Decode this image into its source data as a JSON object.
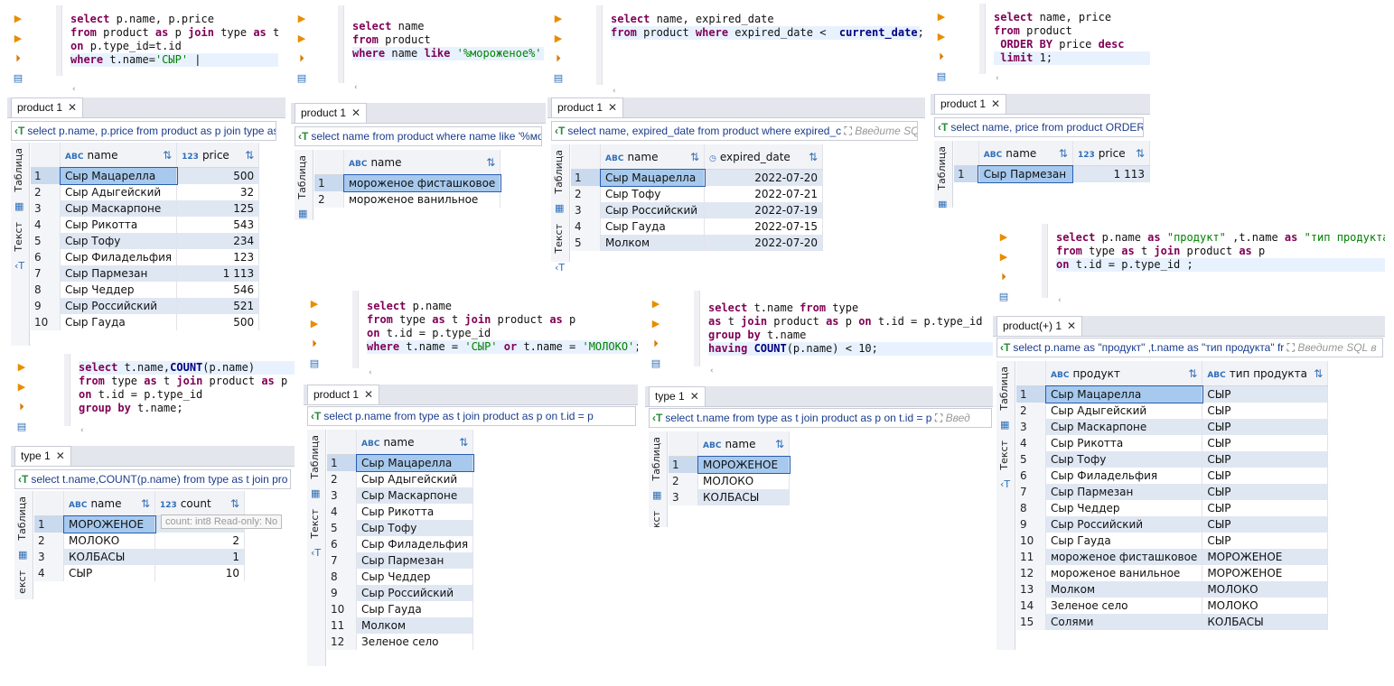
{
  "panels": [
    {
      "sql": [
        [
          [
            "kw",
            "select "
          ],
          [
            "t",
            "p.name, p.price"
          ]
        ],
        [
          [
            "kw",
            "from "
          ],
          [
            "t",
            "product "
          ],
          [
            "kw",
            "as "
          ],
          [
            "t",
            "p "
          ],
          [
            "kw",
            "join "
          ],
          [
            "t",
            "type "
          ],
          [
            "kw",
            "as "
          ],
          [
            "t",
            "t"
          ]
        ],
        [
          [
            "kw",
            "on "
          ],
          [
            "t",
            "p.type_id=t.id"
          ]
        ],
        [
          [
            "kw",
            "where "
          ],
          [
            "t",
            "t.name="
          ],
          [
            "str",
            "'СЫР'"
          ],
          [
            "t",
            " |"
          ]
        ]
      ],
      "tab": "product 1",
      "filter": "select p.name, p.price from product as p join type as t",
      "side_label": "Таблица",
      "side_label2": "Текст",
      "columns": [
        {
          "type": "ABC",
          "name": "name"
        },
        {
          "type": "123",
          "name": "price"
        }
      ],
      "rows": [
        [
          "1",
          "Сыр Мацарелла",
          "500"
        ],
        [
          "2",
          "Сыр Адыгейский",
          "32"
        ],
        [
          "3",
          "Сыр Маскарпоне",
          "125"
        ],
        [
          "4",
          "Сыр Рикотта",
          "543"
        ],
        [
          "5",
          "Сыр Тофу",
          "234"
        ],
        [
          "6",
          "Сыр Филадельфия",
          "123"
        ],
        [
          "7",
          "Сыр Пармезан",
          "1 113"
        ],
        [
          "8",
          "Сыр Чеддер",
          "546"
        ],
        [
          "9",
          "Сыр Российский",
          "521"
        ],
        [
          "10",
          "Сыр Гауда",
          "500"
        ]
      ]
    },
    {
      "sql": [
        [
          [
            "kw",
            "select "
          ],
          [
            "t",
            "name"
          ]
        ],
        [
          [
            "kw",
            "from "
          ],
          [
            "t",
            "product"
          ]
        ],
        [
          [
            "kw",
            "where "
          ],
          [
            "t",
            "name "
          ],
          [
            "kw",
            "like "
          ],
          [
            "str",
            "'%мороженое%'"
          ]
        ]
      ],
      "tab": "product 1",
      "filter": "select name from product where name like '%мо",
      "side_label": "Таблица",
      "columns": [
        {
          "type": "ABC",
          "name": "name"
        }
      ],
      "rows": [
        [
          "1",
          "мороженое фисташковое"
        ],
        [
          "2",
          "мороженое ванильное"
        ]
      ]
    },
    {
      "sql": [
        [
          [
            "kw",
            "select "
          ],
          [
            "t",
            "name, expired_date"
          ]
        ],
        [
          [
            "kw",
            "from "
          ],
          [
            "t",
            "product "
          ],
          [
            "kw",
            "where "
          ],
          [
            "t",
            "expired_date <  "
          ],
          [
            "fn",
            "current_date"
          ],
          [
            "t",
            ";"
          ]
        ]
      ],
      "tab": "product 1",
      "filter": "select name, expired_date from product where expired_c",
      "filter_hint": "Введите SQ",
      "side_label": "Таблица",
      "side_label2": "Текст",
      "columns": [
        {
          "type": "ABC",
          "name": "name"
        },
        {
          "type": "◷",
          "name": "expired_date"
        }
      ],
      "rows": [
        [
          "1",
          "Сыр Мацарелла",
          "2022-07-20"
        ],
        [
          "2",
          "Сыр Тофу",
          "2022-07-21"
        ],
        [
          "3",
          "Сыр Российский",
          "2022-07-19"
        ],
        [
          "4",
          "Сыр Гауда",
          "2022-07-15"
        ],
        [
          "5",
          "Молком",
          "2022-07-20"
        ]
      ]
    },
    {
      "sql": [
        [
          [
            "kw",
            "select "
          ],
          [
            "t",
            "name, price"
          ]
        ],
        [
          [
            "kw",
            "from "
          ],
          [
            "t",
            "product"
          ]
        ],
        [
          [
            "t",
            " "
          ],
          [
            "kw",
            "ORDER BY "
          ],
          [
            "t",
            "price "
          ],
          [
            "kw",
            "desc"
          ]
        ],
        [
          [
            "t",
            " "
          ],
          [
            "kw",
            "limit "
          ],
          [
            "t",
            "1;"
          ]
        ]
      ],
      "tab": "product 1",
      "filter": "select name, price from product ORDER E",
      "side_label": "Таблица",
      "columns": [
        {
          "type": "ABC",
          "name": "name"
        },
        {
          "type": "123",
          "name": "price"
        }
      ],
      "rows": [
        [
          "1",
          "Сыр Пармезан",
          "1 113"
        ]
      ]
    },
    {
      "sql": [
        [
          [
            "kw",
            "select "
          ],
          [
            "t",
            "t.name,"
          ],
          [
            "fn",
            "COUNT"
          ],
          [
            "t",
            "(p.name)"
          ]
        ],
        [
          [
            "kw",
            "from "
          ],
          [
            "t",
            "type "
          ],
          [
            "kw",
            "as "
          ],
          [
            "t",
            "t "
          ],
          [
            "kw",
            "join "
          ],
          [
            "t",
            "product "
          ],
          [
            "kw",
            "as "
          ],
          [
            "t",
            "p"
          ]
        ],
        [
          [
            "kw",
            "on "
          ],
          [
            "t",
            "t.id = p.type_id"
          ]
        ],
        [
          [
            "kw",
            "group by "
          ],
          [
            "t",
            "t.name;"
          ]
        ]
      ],
      "tab": "type 1",
      "filter": "select t.name,COUNT(p.name) from type as t join pro",
      "side_label": "Таблица",
      "side_label2": "екст",
      "tooltip": "count: int8 Read-only: No",
      "columns": [
        {
          "type": "ABC",
          "name": "name"
        },
        {
          "type": "123",
          "name": "count"
        }
      ],
      "rows": [
        [
          "1",
          "МОРОЖЕНОЕ",
          "2"
        ],
        [
          "2",
          "МОЛОКО",
          "2"
        ],
        [
          "3",
          "КОЛБАСЫ",
          "1"
        ],
        [
          "4",
          "СЫР",
          "10"
        ]
      ]
    },
    {
      "sql": [
        [
          [
            "kw",
            "select "
          ],
          [
            "t",
            "p.name"
          ]
        ],
        [
          [
            "kw",
            "from "
          ],
          [
            "t",
            "type "
          ],
          [
            "kw",
            "as "
          ],
          [
            "t",
            "t "
          ],
          [
            "kw",
            "join "
          ],
          [
            "t",
            "product "
          ],
          [
            "kw",
            "as "
          ],
          [
            "t",
            "p"
          ]
        ],
        [
          [
            "kw",
            "on "
          ],
          [
            "t",
            "t.id = p.type_id"
          ]
        ],
        [
          [
            "kw",
            "where "
          ],
          [
            "t",
            "t.name = "
          ],
          [
            "str",
            "'СЫР'"
          ],
          [
            "t",
            " "
          ],
          [
            "kw",
            "or "
          ],
          [
            "t",
            "t.name = "
          ],
          [
            "str",
            "'МОЛОКО'"
          ],
          [
            "t",
            ";"
          ]
        ]
      ],
      "tab": "product 1",
      "filter": "select p.name from type as t join product as p on t.id = p",
      "side_label": "Таблица",
      "side_label2": "Текст",
      "columns": [
        {
          "type": "ABC",
          "name": "name"
        }
      ],
      "rows": [
        [
          "1",
          "Сыр Мацарелла"
        ],
        [
          "2",
          "Сыр Адыгейский"
        ],
        [
          "3",
          "Сыр Маскарпоне"
        ],
        [
          "4",
          "Сыр Рикотта"
        ],
        [
          "5",
          "Сыр Тофу"
        ],
        [
          "6",
          "Сыр Филадельфия"
        ],
        [
          "7",
          "Сыр Пармезан"
        ],
        [
          "8",
          "Сыр Чеддер"
        ],
        [
          "9",
          "Сыр Российский"
        ],
        [
          "10",
          "Сыр Гауда"
        ],
        [
          "11",
          "Молком"
        ],
        [
          "12",
          "Зеленое село"
        ]
      ]
    },
    {
      "sql": [
        [
          [
            "kw",
            "select "
          ],
          [
            "t",
            "t.name "
          ],
          [
            "kw",
            "from "
          ],
          [
            "t",
            "type"
          ]
        ],
        [
          [
            "kw",
            "as "
          ],
          [
            "t",
            "t "
          ],
          [
            "kw",
            "join "
          ],
          [
            "t",
            "product "
          ],
          [
            "kw",
            "as "
          ],
          [
            "t",
            "p "
          ],
          [
            "kw",
            "on "
          ],
          [
            "t",
            "t.id = p.type_id"
          ]
        ],
        [
          [
            "kw",
            "group by "
          ],
          [
            "t",
            "t.name"
          ]
        ],
        [
          [
            "kw",
            "having "
          ],
          [
            "fn",
            "COUNT"
          ],
          [
            "t",
            "(p.name) < "
          ],
          [
            "t",
            "10;"
          ]
        ]
      ],
      "tab": "type 1",
      "filter": "select t.name from type as t join product as p on t.id = p",
      "filter_hint": "Введ",
      "side_label": "Таблица",
      "side_label2": "Текст",
      "columns": [
        {
          "type": "ABC",
          "name": "name"
        }
      ],
      "rows": [
        [
          "1",
          "МОРОЖЕНОЕ"
        ],
        [
          "2",
          "МОЛОКО"
        ],
        [
          "3",
          "КОЛБАСЫ"
        ]
      ]
    },
    {
      "sql": [
        [
          [
            "kw",
            "select "
          ],
          [
            "t",
            "p.name "
          ],
          [
            "kw",
            "as "
          ],
          [
            "str",
            "\"продукт\""
          ],
          [
            "t",
            " ,t.name "
          ],
          [
            "kw",
            "as "
          ],
          [
            "str",
            "\"тип продукта\""
          ]
        ],
        [
          [
            "kw",
            "from "
          ],
          [
            "t",
            "type "
          ],
          [
            "kw",
            "as "
          ],
          [
            "t",
            "t "
          ],
          [
            "kw",
            "join "
          ],
          [
            "t",
            "product "
          ],
          [
            "kw",
            "as "
          ],
          [
            "t",
            "p"
          ]
        ],
        [
          [
            "kw",
            "on "
          ],
          [
            "t",
            "t.id = p.type_id ;"
          ]
        ]
      ],
      "tab": "product(+) 1",
      "filter": "select p.name as \"продукт\" ,t.name as \"тип продукта\" fr",
      "filter_hint": "Введите SQL в",
      "side_label": "Таблица",
      "side_label2": "Текст",
      "columns": [
        {
          "type": "ABC",
          "name": "продукт"
        },
        {
          "type": "ABC",
          "name": "тип продукта"
        }
      ],
      "rows": [
        [
          "1",
          "Сыр Мацарелла",
          "СЫР"
        ],
        [
          "2",
          "Сыр Адыгейский",
          "СЫР"
        ],
        [
          "3",
          "Сыр Маскарпоне",
          "СЫР"
        ],
        [
          "4",
          "Сыр Рикотта",
          "СЫР"
        ],
        [
          "5",
          "Сыр Тофу",
          "СЫР"
        ],
        [
          "6",
          "Сыр Филадельфия",
          "СЫР"
        ],
        [
          "7",
          "Сыр Пармезан",
          "СЫР"
        ],
        [
          "8",
          "Сыр Чеддер",
          "СЫР"
        ],
        [
          "9",
          "Сыр Российский",
          "СЫР"
        ],
        [
          "10",
          "Сыр Гауда",
          "СЫР"
        ],
        [
          "11",
          "мороженое фисташковое",
          "МОРОЖЕНОЕ"
        ],
        [
          "12",
          "мороженое ванильное",
          "МОРОЖЕНОЕ"
        ],
        [
          "13",
          "Молком",
          "МОЛОКО"
        ],
        [
          "14",
          "Зеленое село",
          "МОЛОКО"
        ],
        [
          "15",
          "Солями",
          "КОЛБАСЫ"
        ]
      ]
    }
  ],
  "colors": {
    "keyword": "#7f0055",
    "string": "#008000",
    "selection": "#a6c9ed",
    "alt_row": "#dfe7f3",
    "tab_bar": "#e4e6ee"
  },
  "icons": [
    "run-statement-icon",
    "run-plan-icon",
    "run-script-icon",
    "explain-icon",
    "filter-icon",
    "expand-icon",
    "sort-filter-icon",
    "table-view-icon",
    "text-view-icon",
    "close-tab-icon"
  ]
}
